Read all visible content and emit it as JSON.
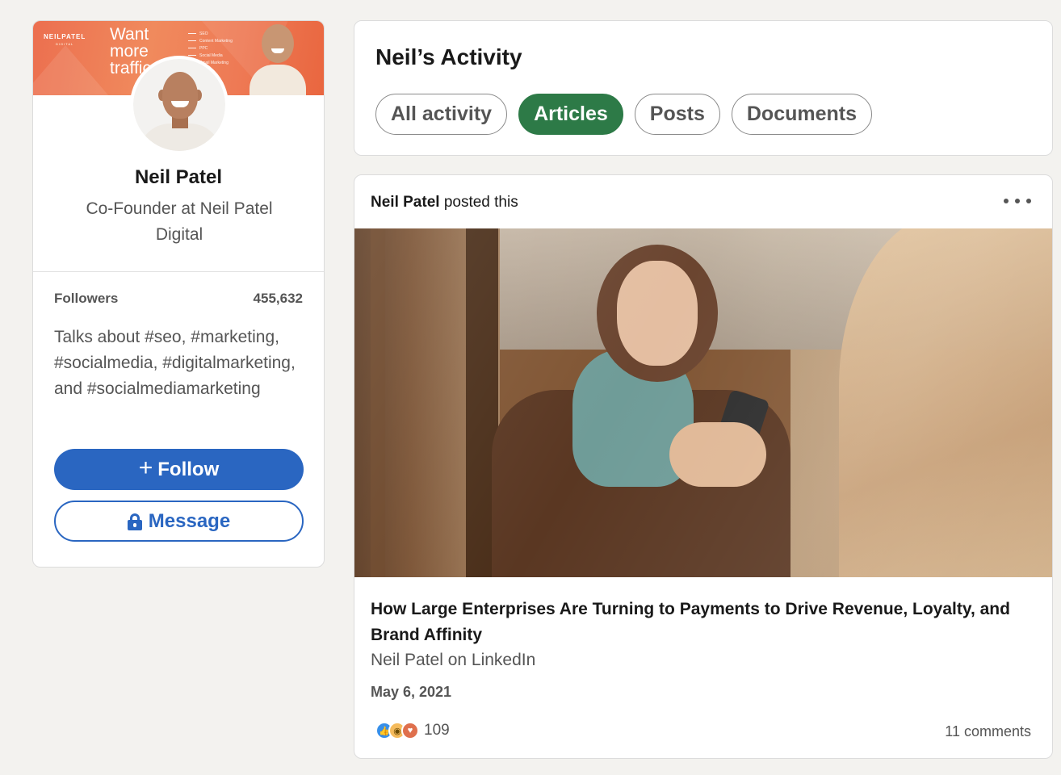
{
  "profile": {
    "banner": {
      "brand": "NEILPATEL",
      "brand_sub": "DIGITAL",
      "headline": "Want more traffic",
      "list": [
        "SEO",
        "Content Marketing",
        "PPC",
        "Social Media",
        "Email Marketing"
      ]
    },
    "name": "Neil Patel",
    "title": "Co-Founder at Neil Patel Digital",
    "followers_label": "Followers",
    "followers_count": "455,632",
    "talks_about": "Talks about #seo, #marketing, #socialmedia, #digitalmarketing, and #socialmediamarketing",
    "follow_label": "Follow",
    "message_label": "Message"
  },
  "activity": {
    "title": "Neil’s Activity",
    "filters": [
      {
        "label": "All activity",
        "active": false
      },
      {
        "label": "Articles",
        "active": true
      },
      {
        "label": "Posts",
        "active": false
      },
      {
        "label": "Documents",
        "active": false
      }
    ]
  },
  "post": {
    "author": "Neil Patel",
    "action": "posted this",
    "title": "How Large Enterprises Are Turning to Payments to Drive Revenue, Loyalty, and Brand Affinity",
    "source": "Neil Patel on LinkedIn",
    "date": "May 6, 2021",
    "reaction_count": "109",
    "reactions": [
      "like-icon",
      "insightful-icon",
      "love-icon"
    ],
    "comments": "11 comments"
  },
  "colors": {
    "page_bg": "#f3f2ef",
    "linkedin_blue": "#2a66c1",
    "active_filter_green": "#2d7a47",
    "banner_orange": "#ec6f4f"
  }
}
